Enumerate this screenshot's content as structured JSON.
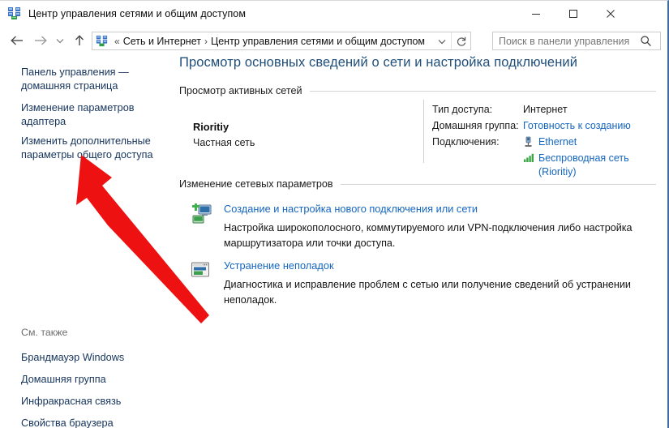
{
  "window": {
    "title": "Центр управления сетями и общим доступом",
    "app_icon": "network-sharing-center-icon",
    "minimize_label": "Свернуть",
    "maximize_label": "Развернуть",
    "close_label": "Закрыть",
    "border_color": "#3a6ea5"
  },
  "navbar": {
    "back_label": "Назад",
    "forward_label": "Вперед",
    "recent_label": "Последние расположения",
    "up_label": "Вверх",
    "address": {
      "icon": "network-sharing-center-icon",
      "overflow": "«",
      "crumbs": [
        "Сеть и Интернет",
        "Центр управления сетями и общим доступом"
      ],
      "separator": "›",
      "dropdown_icon": "chevron-down-icon",
      "refresh_icon": "refresh-icon"
    },
    "search": {
      "placeholder": "Поиск в панели управления",
      "value": "",
      "icon": "search-icon"
    }
  },
  "sidebar": {
    "links": [
      {
        "id": "home",
        "label": "Панель управления — домашняя страница"
      },
      {
        "id": "adapter",
        "label": "Изменение параметров адаптера"
      },
      {
        "id": "sharing",
        "label": "Изменить дополнительные параметры общего доступа"
      }
    ],
    "see_also": {
      "heading": "См. также",
      "items": [
        "Брандмауэр Windows",
        "Домашняя группа",
        "Инфракрасная связь",
        "Свойства браузера"
      ]
    }
  },
  "content": {
    "page_title": "Просмотр основных сведений о сети и настройка подключений",
    "active_networks": {
      "heading": "Просмотр активных сетей",
      "network_name": "Rioritiy",
      "network_type": "Частная сеть",
      "details": {
        "access_type_key": "Тип доступа:",
        "access_type_value": "Интернет",
        "homegroup_key": "Домашняя группа:",
        "homegroup_value": "Готовность к созданию",
        "connections_key": "Подключения:",
        "connections": [
          {
            "icon": "ethernet-icon",
            "label": "Ethernet"
          },
          {
            "icon": "wifi-signal-icon",
            "label": "Беспроводная сеть",
            "label2": "(Rioritiy)"
          }
        ]
      }
    },
    "change_settings": {
      "heading": "Изменение сетевых параметров",
      "items": [
        {
          "icon": "new-connection-icon",
          "link": "Создание и настройка нового подключения или сети",
          "description": "Настройка широкополосного, коммутируемого или VPN-подключения либо настройка маршрутизатора или точки доступа."
        },
        {
          "icon": "troubleshoot-icon",
          "link": "Устранение неполадок",
          "description": "Диагностика и исправление проблем с сетью или получение сведений об устранении неполадок."
        }
      ]
    }
  },
  "annotation": {
    "arrow_color": "#ee1111",
    "arrow_name": "red-pointer-arrow"
  }
}
